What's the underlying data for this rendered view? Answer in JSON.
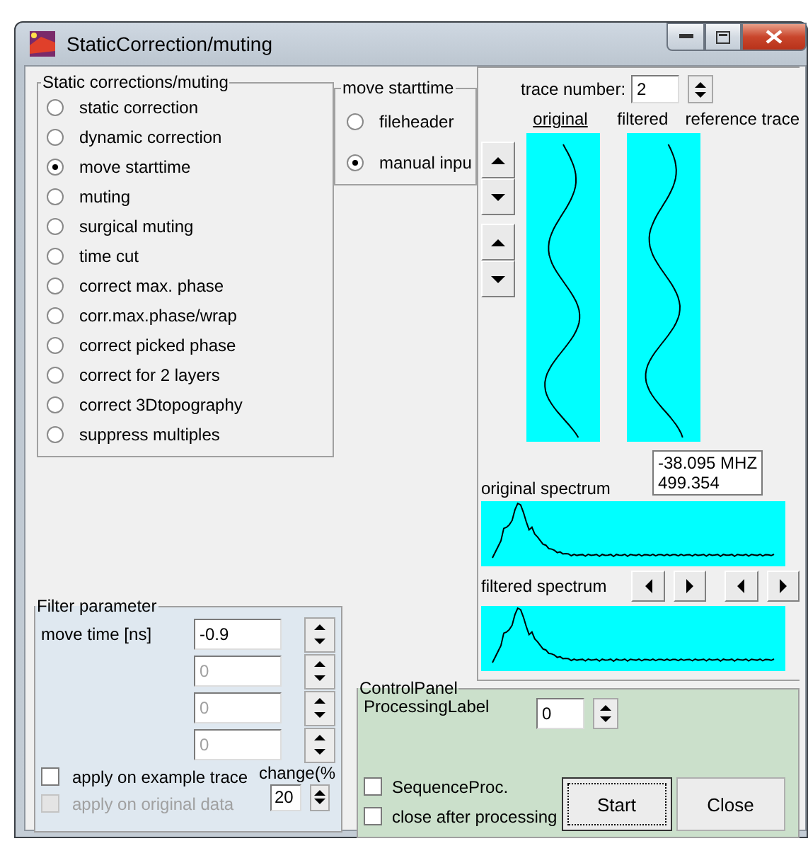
{
  "window": {
    "title": "StaticCorrection/muting"
  },
  "corrections": {
    "legend": "Static corrections/muting",
    "options": [
      {
        "label": "static correction",
        "selected": false
      },
      {
        "label": "dynamic correction",
        "selected": false
      },
      {
        "label": "move starttime",
        "selected": true
      },
      {
        "label": "muting",
        "selected": false
      },
      {
        "label": "surgical muting",
        "selected": false
      },
      {
        "label": "time cut",
        "selected": false
      },
      {
        "label": "correct max. phase",
        "selected": false
      },
      {
        "label": "corr.max.phase/wrap",
        "selected": false
      },
      {
        "label": "correct picked phase",
        "selected": false
      },
      {
        "label": "correct for 2 layers",
        "selected": false
      },
      {
        "label": "correct 3Dtopography",
        "selected": false
      },
      {
        "label": "suppress multiples",
        "selected": false
      }
    ]
  },
  "move_starttime": {
    "legend": "move starttime",
    "options": [
      {
        "label": "fileheader",
        "selected": false
      },
      {
        "label": "manual inpu",
        "selected": true
      }
    ]
  },
  "trace_panel": {
    "trace_number_label": "trace number:",
    "trace_number": "2",
    "columns": [
      "original",
      "filtered",
      "reference trace"
    ],
    "readout": [
      "-38.095 MHZ",
      "499.354"
    ],
    "original_spectrum_label": "original spectrum",
    "filtered_spectrum_label": "filtered spectrum"
  },
  "filter_parameter": {
    "legend": "Filter parameter",
    "fields": [
      {
        "label": "move time [ns]",
        "value": "-0.9",
        "disabled": false
      },
      {
        "value": "0",
        "disabled": true
      },
      {
        "value": "0",
        "disabled": true
      },
      {
        "value": "0",
        "disabled": true
      }
    ],
    "checkboxes": [
      {
        "label": "apply on example trace",
        "checked": false,
        "disabled": false
      },
      {
        "label": "apply on original data",
        "checked": false,
        "disabled": true
      }
    ],
    "change_label": "change(%",
    "change_value": "20"
  },
  "control_panel": {
    "legend": "ControlPanel",
    "processing_label": "ProcessingLabel",
    "processing_value": "0",
    "checkboxes": [
      {
        "label": "SequenceProc.",
        "checked": false
      },
      {
        "label": "close after processing",
        "checked": false
      }
    ],
    "buttons": [
      {
        "label": "Start",
        "focused": true
      },
      {
        "label": "Close",
        "focused": false
      }
    ]
  }
}
